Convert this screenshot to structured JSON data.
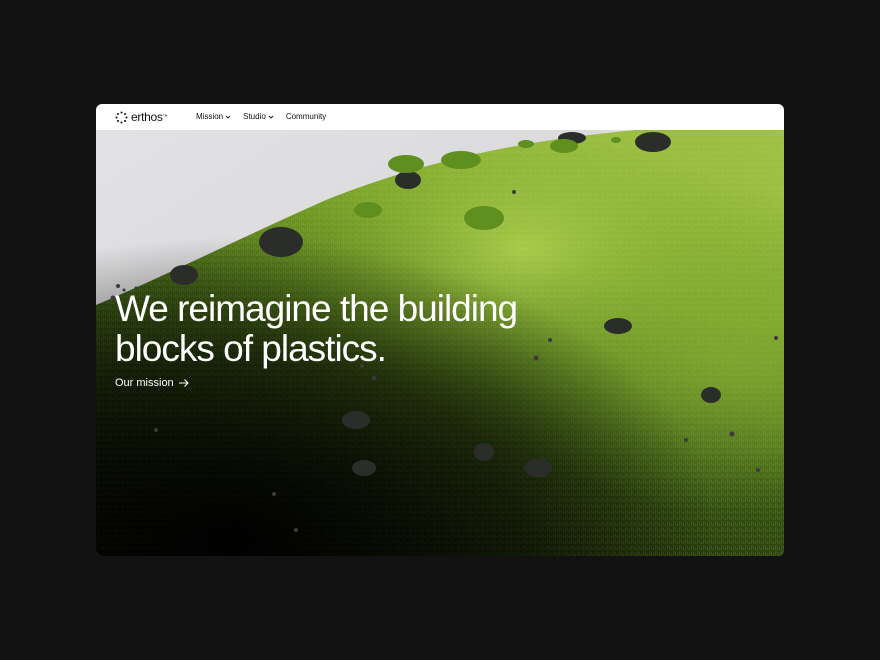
{
  "brand": {
    "name": "erthos",
    "trademark": "™"
  },
  "nav": {
    "items": [
      {
        "label": "Mission",
        "has_dropdown": true
      },
      {
        "label": "Studio",
        "has_dropdown": true
      },
      {
        "label": "Community",
        "has_dropdown": false
      }
    ]
  },
  "hero": {
    "headline_line1": "We reimagine the building",
    "headline_line2": "blocks of plastics.",
    "cta_label": "Our mission",
    "cta_icon": "arrow-right-icon",
    "image": "moss-covered-hill-illustration"
  },
  "colors": {
    "page_background": "#121212",
    "navbar_background": "#ffffff",
    "sky": "#d9d9db",
    "moss_light": "#9dc03a",
    "moss_mid": "#5f8a1e",
    "moss_dark": "#1d2a0b",
    "text_on_hero": "#ffffff"
  }
}
